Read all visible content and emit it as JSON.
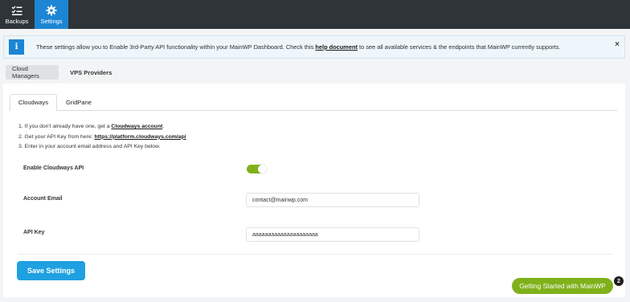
{
  "topbar": {
    "items": [
      {
        "label": "Backups",
        "icon": "list-check-icon"
      },
      {
        "label": "Settings",
        "icon": "gear-icon",
        "active": true
      }
    ],
    "active_color": "#1c86d4",
    "bg_color": "#2f3439"
  },
  "notice": {
    "icon": "info-icon",
    "icon_text": "i",
    "text_before": "These settings allow you to Enable 3rd-Party API functionality within your MainWP Dashboard. Check this ",
    "link": "help document",
    "text_after": " to see all available services & the endpoints that MainWP currently supports.",
    "close": "×"
  },
  "segments": {
    "cloud_managers": "Cloud Managers",
    "vps_providers": "VPS Providers"
  },
  "tabs": {
    "cloudways": "Cloudways",
    "gridpane": "GridPane"
  },
  "steps": {
    "s1_before": "1. If you don't already have one, get a ",
    "s1_link": "Cloudways account",
    "s1_after": ".",
    "s2_before": "2. Get your API Key from here: ",
    "s2_link": "https://platform.cloudways.com/api",
    "s3": "3. Enter in your account email address and API Key below."
  },
  "form": {
    "enable_label": "Enable Cloudways API",
    "enable_on": true,
    "email_label": "Account Email",
    "email_value": "contact@mainwp.com",
    "apikey_label": "API Key",
    "apikey_value": "aaaaaaaaaaaaaaaaaaaaa"
  },
  "save_button": "Save Settings",
  "getting_started": {
    "label": "Getting Started with MainWP",
    "badge": "2",
    "color": "#7fb11b"
  }
}
